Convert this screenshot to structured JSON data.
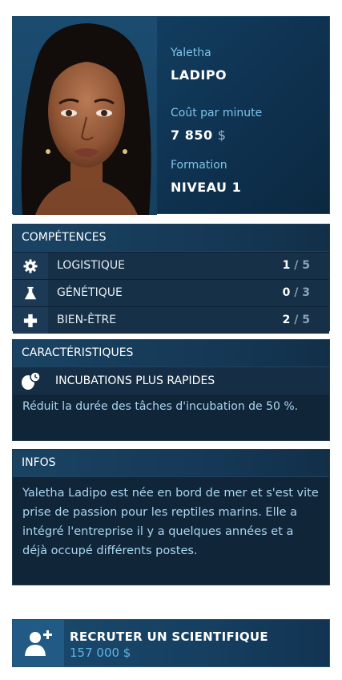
{
  "profile": {
    "first_name": "Yaletha",
    "last_name": "LADIPO",
    "cost_label": "Coût par minute",
    "cost_value": "7 850",
    "currency": "$",
    "training_label": "Formation",
    "training_value": "NIVEAU 1"
  },
  "skills": {
    "title": "COMPÉTENCES",
    "items": [
      {
        "icon": "gear-icon",
        "name": "LOGISTIQUE",
        "value": "1",
        "max": "/ 5"
      },
      {
        "icon": "flask-icon",
        "name": "GÉNÉTIQUE",
        "value": "0",
        "max": "/ 3"
      },
      {
        "icon": "cross-icon",
        "name": "BIEN-ÊTRE",
        "value": "2",
        "max": "/ 5"
      }
    ]
  },
  "traits": {
    "title": "CARACTÉRISTIQUES",
    "name": "INCUBATIONS PLUS RAPIDES",
    "icon": "egg-clock-icon",
    "description": "Réduit la durée des tâches d'incubation de 50 %."
  },
  "infos": {
    "title": "INFOS",
    "text": "Yaletha Ladipo est née en bord de mer et s'est vite prise de passion pour les reptiles marins. Elle a intégré l'entreprise il y a quelques années et a déjà occupé différents postes."
  },
  "recruit": {
    "label": "RECRUTER UN SCIENTIFIQUE",
    "price": "157 000 $",
    "icon": "add-person-icon"
  },
  "colors": {
    "accent": "#7fc3ea",
    "panel": "#112538",
    "header": "#1a4363",
    "price": "#5fb3e3"
  }
}
